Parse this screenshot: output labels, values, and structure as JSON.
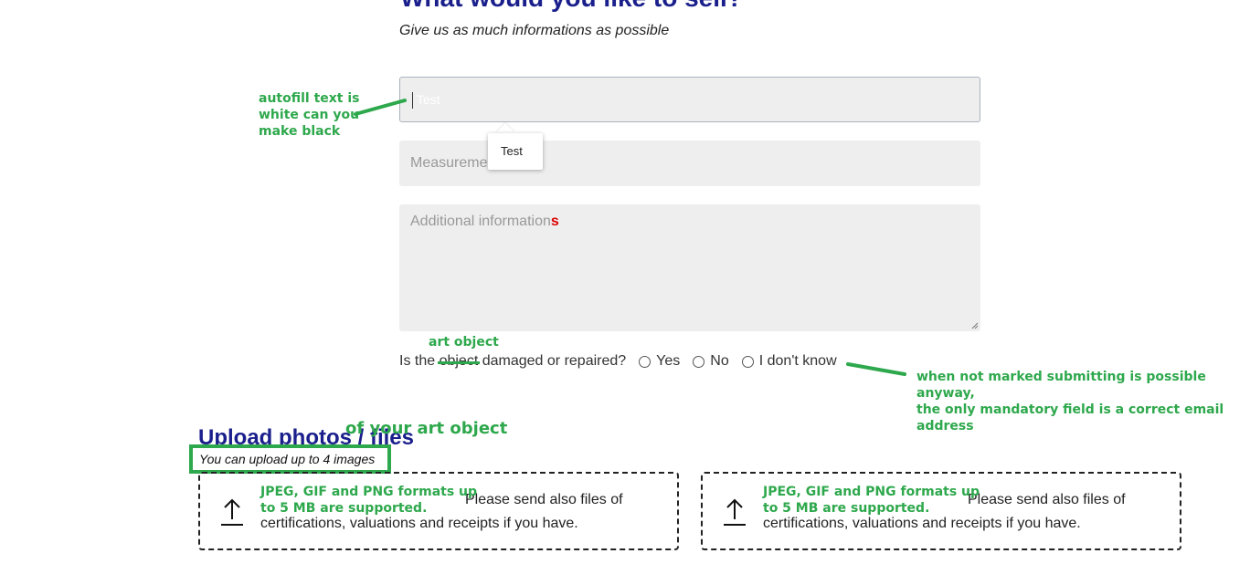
{
  "form": {
    "heading_cut": "What would you like to sell?",
    "subtitle": "Give us as much informations as possible",
    "title_field": {
      "value": "",
      "ghost_text": "Test"
    },
    "measurements_field": {
      "placeholder": "Measurements"
    },
    "autofill_dropdown": {
      "option": "Test"
    },
    "additional_field": {
      "placeholder_main": "Additional information",
      "placeholder_suffix": "s"
    },
    "damaged_question": {
      "prefix": "Is the ",
      "struck_word": "object",
      "suffix": " damaged or repaired?"
    },
    "radio_options": [
      "Yes",
      "No",
      "I don't know"
    ]
  },
  "upload": {
    "title": "Upload photos / files",
    "note": "You can upload up to 4 images",
    "dropzones": [
      {
        "text_line1": "Please send also files of",
        "text_line2": "certifications, valuations and receipts if you have."
      },
      {
        "text_line1": "Please send also files of",
        "text_line2": "certifications, valuations and receipts if you have."
      }
    ]
  },
  "annotations": {
    "autofill_note": [
      "autofill text is",
      "white can you",
      "make black"
    ],
    "art_object": "art object",
    "radio_note": [
      "when not marked submitting is possible anyway,",
      "the only mandatory field is a correct email",
      "address"
    ],
    "upload_title_note": "of your art object",
    "formats_note": [
      "JPEG, GIF and PNG formats up",
      "to 5 MB are supported."
    ],
    "color": "#2ea84c"
  }
}
